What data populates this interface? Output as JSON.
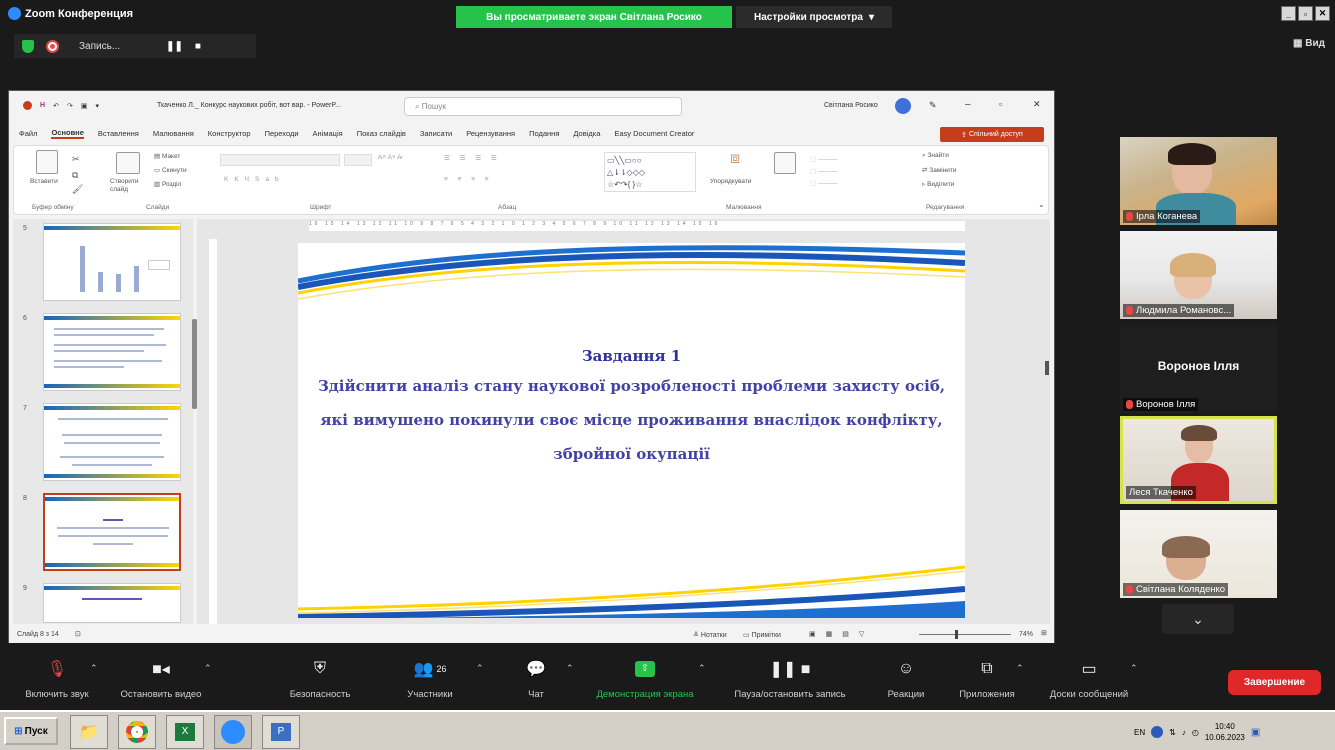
{
  "window": {
    "title": "Zoom Конференция",
    "share_banner": "Вы просматриваете экран Світлана Росико",
    "view_settings": "Настройки просмотра",
    "view_button": "Вид"
  },
  "recording": {
    "label": "Запись..."
  },
  "powerpoint": {
    "doc_title": "Ткаченко Л._ Конкурс наукових робіт, вот вар. - PowerP...",
    "search_placeholder": "Пошук",
    "user": "Світлана Росико",
    "tabs": [
      "Файл",
      "Основне",
      "Вставлення",
      "Малювання",
      "Конструктор",
      "Переходи",
      "Анімація",
      "Показ слайдів",
      "Записати",
      "Рецензування",
      "Подання",
      "Довідка",
      "Easy Document Creator"
    ],
    "active_tab": "Основне",
    "share_button": "Спільний доступ",
    "ribbon_groups": [
      "Буфер обміну",
      "Слайди",
      "Шрифт",
      "Абзац",
      "Малювання",
      "Редагування"
    ],
    "ribbon_labels": {
      "paste": "Вставити",
      "new_slide": "Створити слайд",
      "layout": "Макет",
      "reset": "Скинути",
      "section": "Розділ",
      "arrange": "Упорядкувати",
      "find": "Знайти",
      "replace": "Замінити",
      "select": "Виділити"
    },
    "thumb_numbers": [
      "5",
      "6",
      "7",
      "8",
      "9"
    ],
    "slide": {
      "title": "Завдання 1",
      "lines": [
        "Здійснити аналіз стану наукової розробленості проблеми захисту осіб,",
        "які вимушено покинули своє місце проживання внаслідок конфлікту,",
        "збройної окупації"
      ]
    },
    "status": {
      "slide_count": "Слайд 8 з 14",
      "notes": "Нотатки",
      "comments": "Примітки",
      "zoom": "74%"
    },
    "accent": "#c43e1c"
  },
  "participants": [
    {
      "name": "Ірла Коганева",
      "muted": true
    },
    {
      "name": "Людмила Романовс...",
      "muted": true
    },
    {
      "name": "Воронов Ілля",
      "muted": true,
      "display_name": "Воронов Ілля"
    },
    {
      "name": "Леся Ткаченко",
      "muted": false,
      "active": true
    },
    {
      "name": "Світлана Коляденко",
      "muted": true
    }
  ],
  "toolbar": {
    "unmute": "Включить звук",
    "stop_video": "Остановить видео",
    "security": "Безопасность",
    "participants": "Участники",
    "participants_count": "26",
    "chat": "Чат",
    "share_screen": "Демонстрация экрана",
    "pause_record": "Пауза/остановить запись",
    "reactions": "Реакции",
    "apps": "Приложения",
    "whiteboards": "Доски сообщений",
    "end": "Завершение",
    "share_color": "#27c24c"
  },
  "taskbar": {
    "start": "Пуск",
    "lang": "EN",
    "time": "10:40",
    "date": "10.06.2023"
  }
}
